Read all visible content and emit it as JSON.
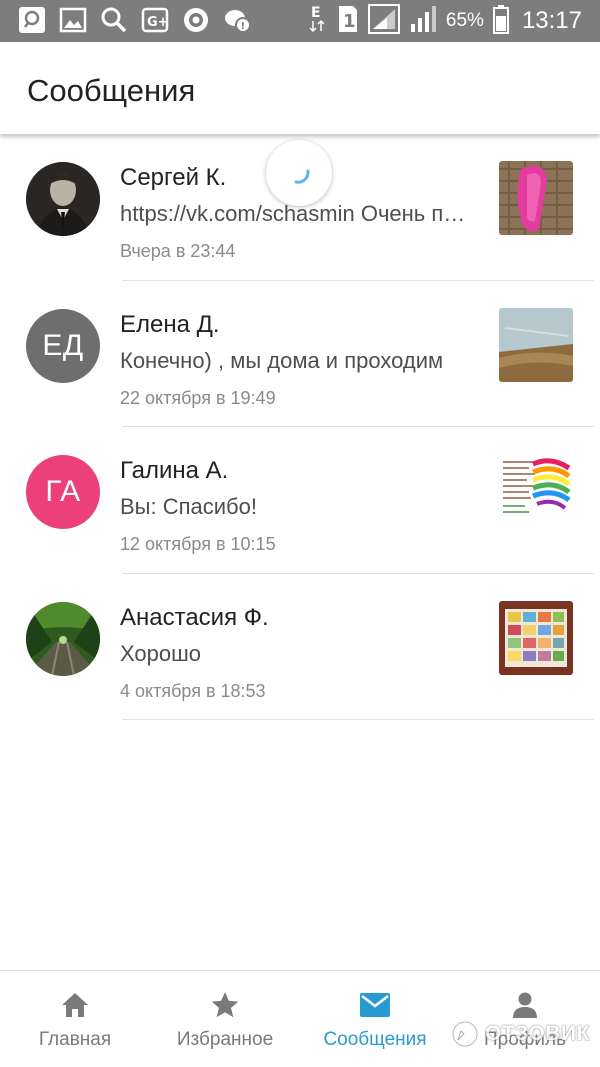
{
  "status_bar": {
    "battery_percent": "65%",
    "time": "13:17",
    "sim_badge": "1",
    "network_letter": "E",
    "icons": [
      "search-status-icon",
      "gallery-icon",
      "search-icon",
      "google-plus-icon",
      "shield-icon",
      "chat-notification-icon"
    ]
  },
  "header": {
    "title": "Сообщения"
  },
  "conversations": [
    {
      "name": "Сергей К.",
      "preview": "https://vk.com/schasmin Очень понравилось",
      "time": "Вчера в 23:44",
      "avatar_type": "photo"
    },
    {
      "name": "Елена Д.",
      "preview": "Конечно) , мы дома и проходим",
      "time": "22 октября в 19:49",
      "avatar_initials": "ЕД",
      "avatar_color": "#6e6e6e"
    },
    {
      "name": "Галина А.",
      "preview": "Вы: Спасибо!",
      "time": "12 октября в 10:15",
      "avatar_initials": "ГА",
      "avatar_color": "#ec407a"
    },
    {
      "name": "Анастасия Ф.",
      "preview": "Хорошо",
      "time": "4 октября в 18:53",
      "avatar_type": "photo"
    }
  ],
  "bottom_nav": {
    "items": [
      {
        "label": "Главная",
        "icon": "home-icon",
        "active": false
      },
      {
        "label": "Избранное",
        "icon": "star-icon",
        "active": false
      },
      {
        "label": "Сообщения",
        "icon": "envelope-icon",
        "active": true
      },
      {
        "label": "Профиль",
        "icon": "person-icon",
        "active": false
      }
    ]
  },
  "watermark": {
    "text": "ОТЗОВИК"
  },
  "colors": {
    "status_bar": "#7d7d7d",
    "accent": "#2a9bd2",
    "inactive_nav": "#7a7a7a",
    "divider": "#e2e2e2"
  }
}
